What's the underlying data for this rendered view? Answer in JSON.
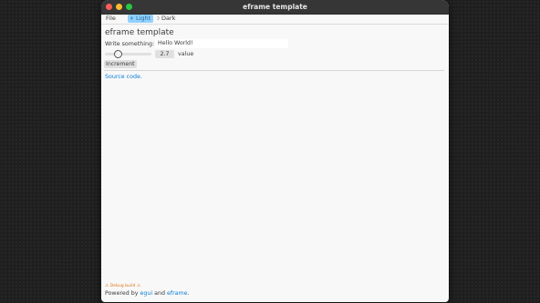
{
  "window": {
    "title": "eframe template"
  },
  "menu": {
    "file": "File"
  },
  "theme": {
    "light_label": "Light",
    "dark_label": "Dark"
  },
  "main": {
    "heading": "eframe template",
    "write_label": "Write something:",
    "text_value": "Hello World!",
    "slider_value": "2.7",
    "value_label": "value",
    "increment_label": "Increment",
    "source_link": "Source code."
  },
  "footer": {
    "debug_warning": "⚠ Debug build ⚠",
    "powered_by": "Powered by ",
    "egui": "egui",
    "and": " and ",
    "eframe": "eframe",
    "period": "."
  },
  "colors": {
    "accent": "#0b7fd4",
    "selected_bg": "#90d1ff",
    "warning": "#e07a1e"
  }
}
